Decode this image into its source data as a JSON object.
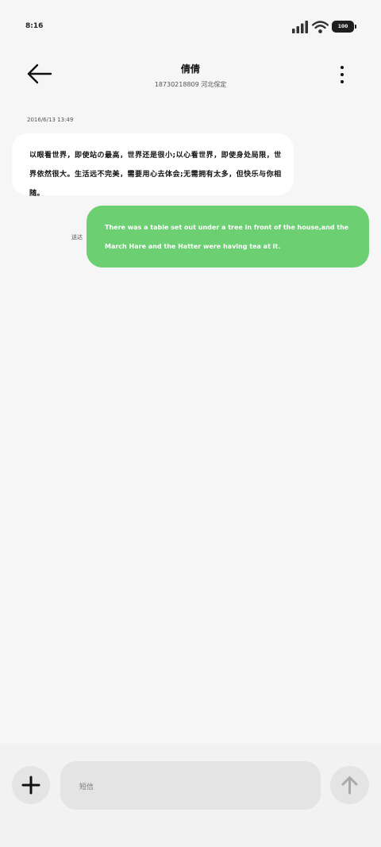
{
  "status_bar": {
    "time": "8:16",
    "battery_level": "100",
    "icons": [
      "signal-icon",
      "wifi-icon",
      "battery-icon"
    ]
  },
  "header": {
    "contact_name": "倩倩",
    "contact_subtitle": "18730218809 河北保定",
    "icons": [
      "back-arrow-icon",
      "more-vertical-icon"
    ]
  },
  "conversation": {
    "timestamp": "2016/6/13 13:49",
    "messages": [
      {
        "direction": "incoming",
        "text": "以眼看世界，即使站の最高，世界还是很小;以心看世界，即使身处局限，世界依然很大。生活远不完美，需要用心去体会;无需拥有太多，但快乐与你相随。"
      },
      {
        "direction": "outgoing",
        "status": "送达",
        "text": "There was a table set out under a tree in front of the house,and the March Hare and the Hatter were having tea at it."
      }
    ]
  },
  "composer": {
    "placeholder": "短信",
    "icons": [
      "plus-icon",
      "send-arrow-icon"
    ]
  },
  "colors": {
    "background": "#f6f6f6",
    "outgoing_bubble": "#6ccf72",
    "incoming_bubble": "#ffffff",
    "composer_controls": "#e4e4e4"
  }
}
